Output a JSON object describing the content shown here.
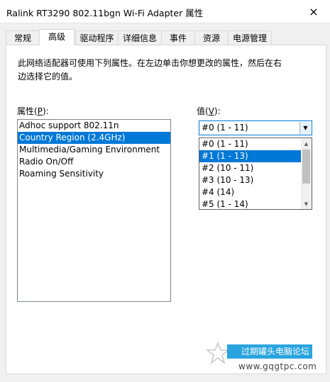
{
  "window": {
    "title": "Ralink RT3290 802.11bgn Wi-Fi Adapter 属性",
    "close_icon": "×"
  },
  "tabs": [
    {
      "label": "常规"
    },
    {
      "label": "高级",
      "active": true
    },
    {
      "label": "驱动程序"
    },
    {
      "label": "详细信息"
    },
    {
      "label": "事件"
    },
    {
      "label": "资源"
    },
    {
      "label": "电源管理"
    }
  ],
  "advanced": {
    "description": "此网络适配器可使用下列属性。在左边单击你想更改的属性，然后在右边选择它的值。",
    "property_label": "属性(",
    "property_key": "P",
    "property_end": "):",
    "value_label": "值(",
    "value_key": "V",
    "value_end": "):",
    "properties": [
      "Adhoc support 802.11n",
      "Country Region (2.4GHz)",
      "Multimedia/Gaming Environment",
      "Radio On/Off",
      "Roaming Sensitivity"
    ],
    "selected_property_index": 1,
    "value_combo": "#0 (1 - 11)",
    "value_options": [
      "#0 (1 - 11)",
      "#1 (1 - 13)",
      "#2 (10 - 11)",
      "#3 (10 - 13)",
      "#4 (14)",
      "#5 (1 - 14)"
    ],
    "highlighted_value_index": 1
  },
  "watermark": {
    "text": "过期罐头电脑论坛",
    "url": "www.gqgtpc.com"
  },
  "colors": {
    "selection": "#0078d7",
    "watermark_bg": "#2aa4de"
  }
}
